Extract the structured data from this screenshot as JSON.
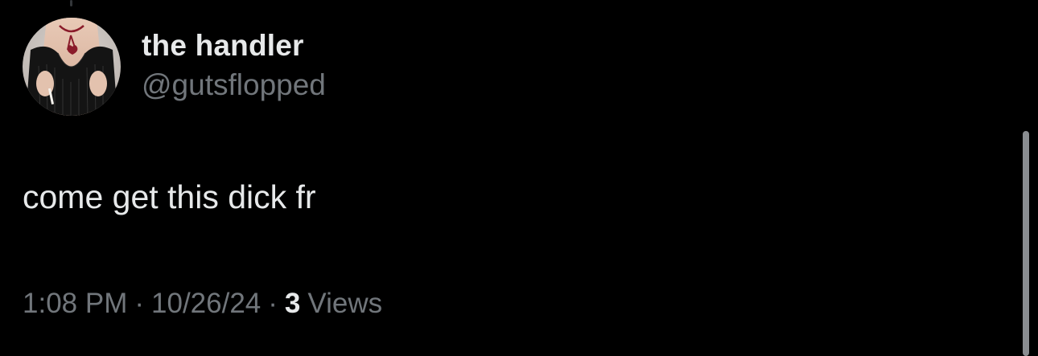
{
  "author": {
    "display_name": "the handler",
    "handle": "@gutsflopped",
    "avatar_icon": "user-avatar-photo"
  },
  "tweet": {
    "text": "come get this dick fr"
  },
  "meta": {
    "time": "1:08 PM",
    "separator": "·",
    "date": "10/26/24",
    "views_count": "3",
    "views_label": "Views"
  },
  "colors": {
    "background": "#000000",
    "primary_text": "#e7e9ea",
    "secondary_text": "#71767b"
  }
}
